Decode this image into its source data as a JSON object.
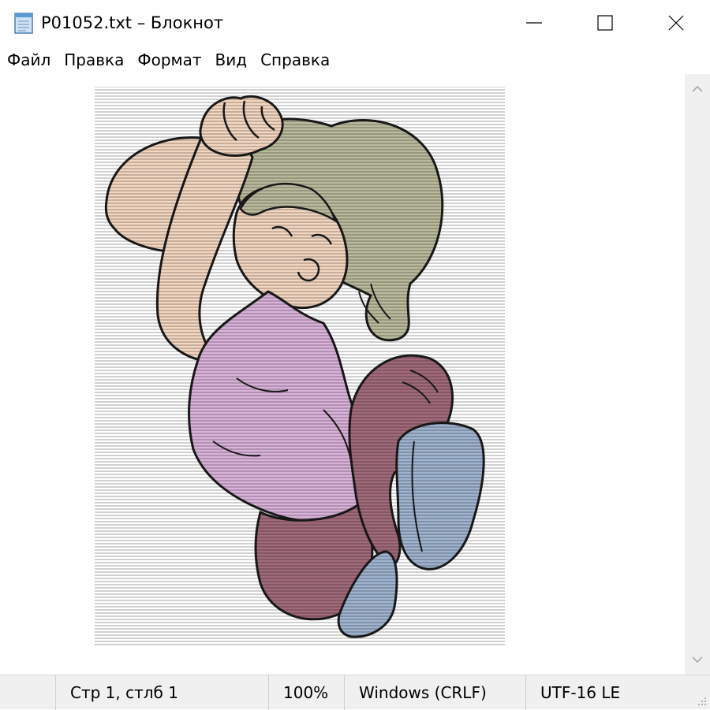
{
  "window": {
    "title": "P01052.txt – Блокнот",
    "icon": "notepad-icon",
    "controls": [
      "minimize-icon",
      "maximize-icon",
      "close-icon"
    ]
  },
  "menu": {
    "items": [
      {
        "label": "Файл"
      },
      {
        "label": "Правка"
      },
      {
        "label": "Формат"
      },
      {
        "label": "Вид"
      },
      {
        "label": "Справка"
      }
    ]
  },
  "document": {
    "content": "ASCII-art illustration: cartoon person jumping with hands clasped above head"
  },
  "colors": {
    "hair": "#b9b99c",
    "skin": "#f2d6c0",
    "shirt": "#d9b2d9",
    "pants": "#a06a7a",
    "shoes": "#9fb3cf",
    "outline": "#1a1a1a"
  },
  "status": {
    "position": "Стр 1, стлб 1",
    "zoom": "100%",
    "line_ending": "Windows (CRLF)",
    "encoding": "UTF-16 LE"
  }
}
